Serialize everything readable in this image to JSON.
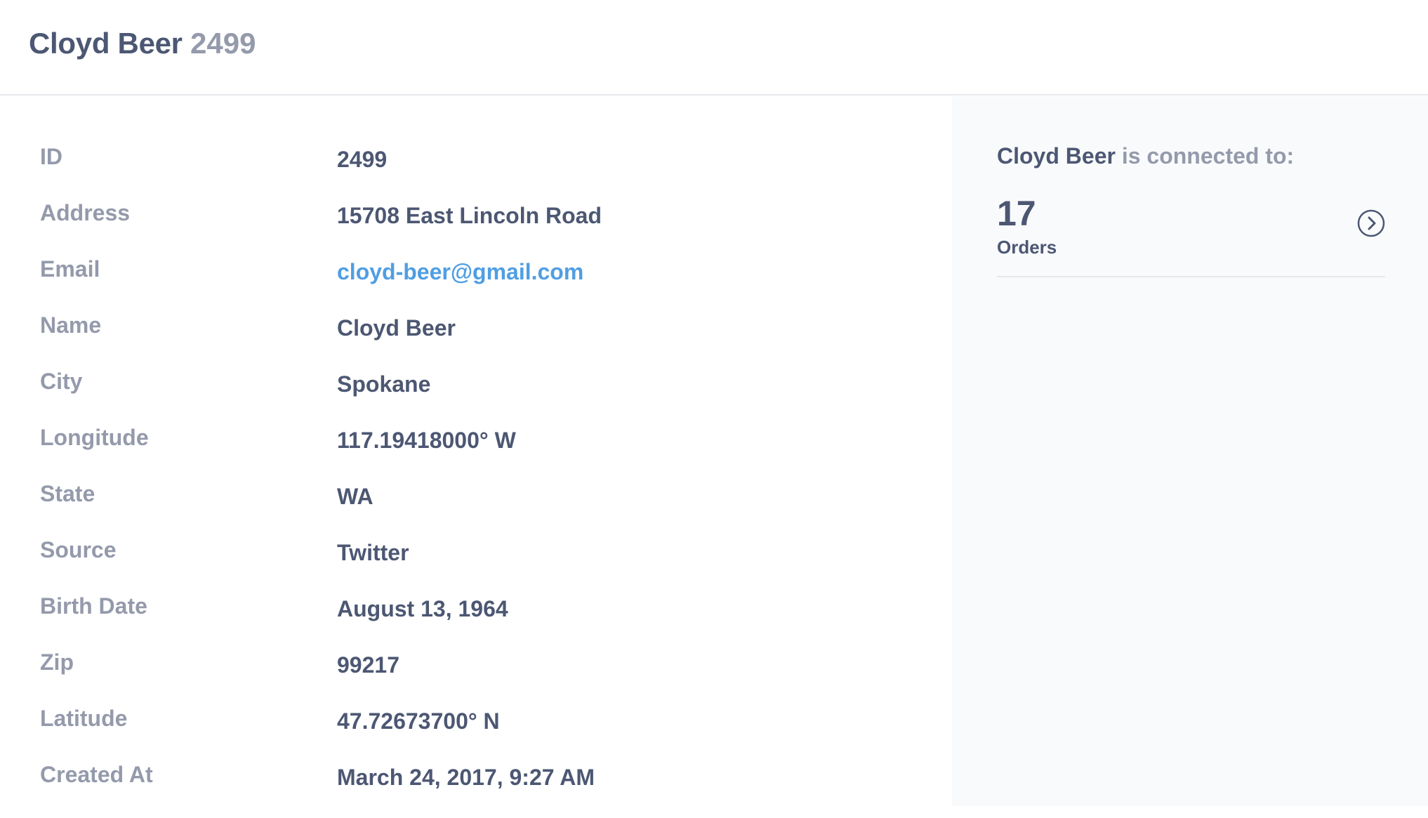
{
  "header": {
    "title": "Cloyd Beer",
    "id": "2499"
  },
  "fields": [
    {
      "label": "ID",
      "value": "2499"
    },
    {
      "label": "Address",
      "value": "15708 East Lincoln Road"
    },
    {
      "label": "Email",
      "value": "cloyd-beer@gmail.com",
      "link": true
    },
    {
      "label": "Name",
      "value": "Cloyd Beer"
    },
    {
      "label": "City",
      "value": "Spokane"
    },
    {
      "label": "Longitude",
      "value": "117.19418000° W"
    },
    {
      "label": "State",
      "value": "WA"
    },
    {
      "label": "Source",
      "value": "Twitter"
    },
    {
      "label": "Birth Date",
      "value": "August 13, 1964"
    },
    {
      "label": "Zip",
      "value": "99217"
    },
    {
      "label": "Latitude",
      "value": "47.72673700° N"
    },
    {
      "label": "Created At",
      "value": "March 24, 2017, 9:27 AM"
    }
  ],
  "connections": {
    "subject": "Cloyd Beer",
    "heading_suffix": "is connected to:",
    "items": [
      {
        "count": "17",
        "label": "Orders",
        "icon": "chevron-right-circle-icon"
      }
    ]
  },
  "colors": {
    "text": "#4c5773",
    "muted": "#949aab",
    "link": "#509ee3",
    "border": "#e6e8ec",
    "sidebar_bg": "#f9fafb"
  }
}
